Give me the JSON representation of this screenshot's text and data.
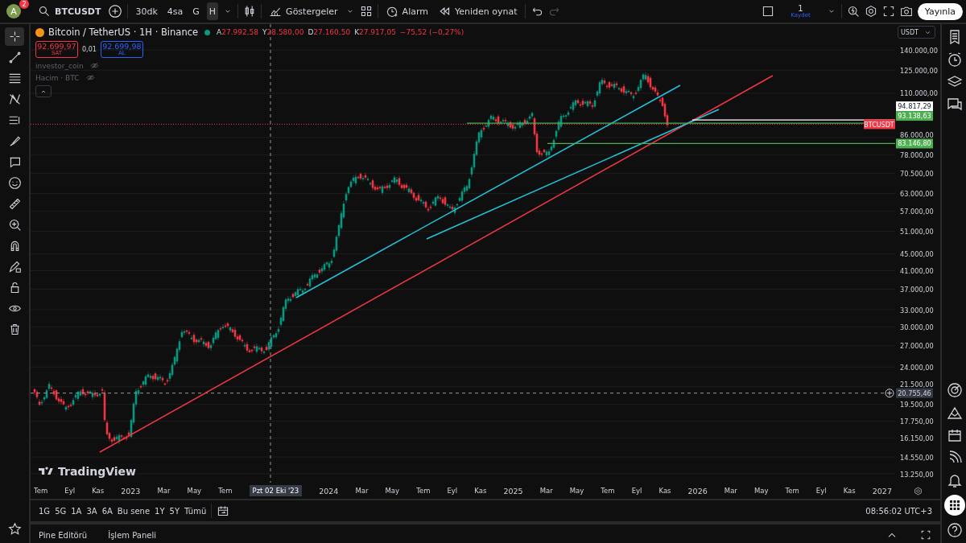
{
  "top_bar": {
    "avatar": {
      "letter": "A",
      "badge": "2"
    },
    "symbol": "BTCUSDT",
    "intervals": [
      {
        "label": "30dk",
        "selected": false
      },
      {
        "label": "4sa",
        "selected": false
      },
      {
        "label": "G",
        "selected": false
      },
      {
        "label": "H",
        "selected": true
      }
    ],
    "indicators": "Göstergeler",
    "alert": "Alarm",
    "replay": "Yeniden oynat",
    "save": {
      "count": "1",
      "label": "Kaydet"
    },
    "publish": "Yayınla"
  },
  "left_toolbar": [
    {
      "selected": true
    },
    {
      "selected": false
    },
    {
      "selected": false
    },
    {
      "selected": false
    },
    {
      "selected": false
    },
    {
      "selected": false
    },
    {
      "selected": false
    },
    {
      "selected": false
    },
    {
      "selected": false
    },
    {
      "selected": false
    },
    {
      "selected": false
    },
    {
      "selected": false
    },
    {
      "selected": false
    },
    {
      "selected": false
    },
    {
      "selected": false
    }
  ],
  "legend": {
    "title": "Bitcoin / TetherUS · 1H · Binance",
    "ohlc": [
      {
        "key": "A",
        "value": "27.992,58"
      },
      {
        "key": "Y",
        "value": "28.580,00"
      },
      {
        "key": "D",
        "value": "27.160,50"
      },
      {
        "key": "K",
        "value": "27.917,05"
      }
    ],
    "change": "−75,52 (−0,27%)",
    "sell": {
      "price": "92.699,97",
      "label": "SAT"
    },
    "spread": "0,01",
    "buy": {
      "price": "92.699,98",
      "label": "AL"
    },
    "indicators": [
      {
        "name": "investor_coin"
      },
      {
        "name": "Hacim · BTC"
      }
    ]
  },
  "chart": {
    "logo": "TradingView",
    "symbol_tag": "BTCUSDT"
  },
  "price_axis": {
    "currency": "USDT",
    "ticks": [
      "140.000,00",
      "125.000,00",
      "110.000,00",
      "86.000,00",
      "78.000,00",
      "70.500,00",
      "63.000,00",
      "57.000,00",
      "51.000,00",
      "45.000,00",
      "41.000,00",
      "37.000,00",
      "33.000,00",
      "30.000,00",
      "27.000,00",
      "24.000,00",
      "21.500,00",
      "19.500,00",
      "17.750,00",
      "16.150,00",
      "14.550,00",
      "13.250,00"
    ],
    "tags": [
      {
        "value": "94.817,29",
        "color": "#ffffff"
      },
      {
        "value": "93.138,63",
        "color": "#4caf50"
      },
      {
        "value": "83.146,80",
        "color": "#4caf50"
      }
    ],
    "crosshair": "20.755,46"
  },
  "time_axis": {
    "labels": [
      {
        "text": "Tem",
        "kind": "month"
      },
      {
        "text": "Eyl",
        "kind": "month"
      },
      {
        "text": "Kas",
        "kind": "month"
      },
      {
        "text": "2023",
        "kind": "year"
      },
      {
        "text": "Mar",
        "kind": "month"
      },
      {
        "text": "May",
        "kind": "month"
      },
      {
        "text": "Tem",
        "kind": "month"
      },
      {
        "text": "Pzt 02 Eki '23",
        "kind": "crosshair"
      },
      {
        "text": "2024",
        "kind": "year"
      },
      {
        "text": "Mar",
        "kind": "month"
      },
      {
        "text": "May",
        "kind": "month"
      },
      {
        "text": "Tem",
        "kind": "month"
      },
      {
        "text": "Eyl",
        "kind": "month"
      },
      {
        "text": "Kas",
        "kind": "month"
      },
      {
        "text": "2025",
        "kind": "year"
      },
      {
        "text": "Mar",
        "kind": "month"
      },
      {
        "text": "May",
        "kind": "month"
      },
      {
        "text": "Tem",
        "kind": "month"
      },
      {
        "text": "Eyl",
        "kind": "month"
      },
      {
        "text": "Kas",
        "kind": "month"
      },
      {
        "text": "2026",
        "kind": "year"
      },
      {
        "text": "Mar",
        "kind": "month"
      },
      {
        "text": "May",
        "kind": "month"
      },
      {
        "text": "Tem",
        "kind": "month"
      },
      {
        "text": "Eyl",
        "kind": "month"
      },
      {
        "text": "Kas",
        "kind": "month"
      },
      {
        "text": "2027",
        "kind": "year"
      }
    ]
  },
  "range_bar": {
    "ranges": [
      "1G",
      "5G",
      "1A",
      "3A",
      "6A",
      "Bu sene",
      "1Y",
      "5Y",
      "Tümü"
    ],
    "clock": "08:56:02 UTC+3"
  },
  "bottom_panel": {
    "tabs": [
      "Pine Editörü",
      "İşlem Paneli"
    ]
  }
}
